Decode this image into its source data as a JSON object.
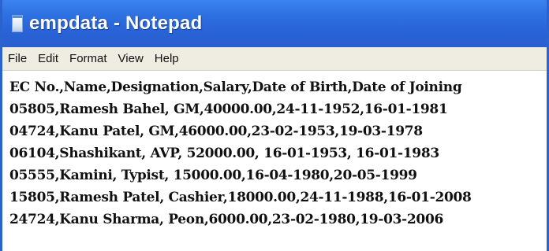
{
  "window": {
    "title": "empdata - Notepad",
    "icon": "notepad-icon"
  },
  "menubar": {
    "items": [
      "File",
      "Edit",
      "Format",
      "View",
      "Help"
    ]
  },
  "editor": {
    "lines": [
      "EC No.,Name,Designation,Salary,Date of Birth,Date of Joining",
      "05805,Ramesh Bahel, GM,40000.00,24-11-1952,16-01-1981",
      "04724,Kanu Patel, GM,46000.00,23-02-1953,19-03-1978",
      "06104,Shashikant, AVP, 52000.00, 16-01-1953, 16-01-1983",
      "05555,Kamini, Typist, 15000.00,16-04-1980,20-05-1999",
      "15805,Ramesh Patel, Cashier,18000.00,24-11-1988,16-01-2008",
      "24724,Kanu Sharma, Peon,6000.00,23-02-1980,19-03-2006"
    ]
  },
  "colors": {
    "titlebar": "#2862d6",
    "menubar": "#efece2",
    "text": "#111111"
  }
}
